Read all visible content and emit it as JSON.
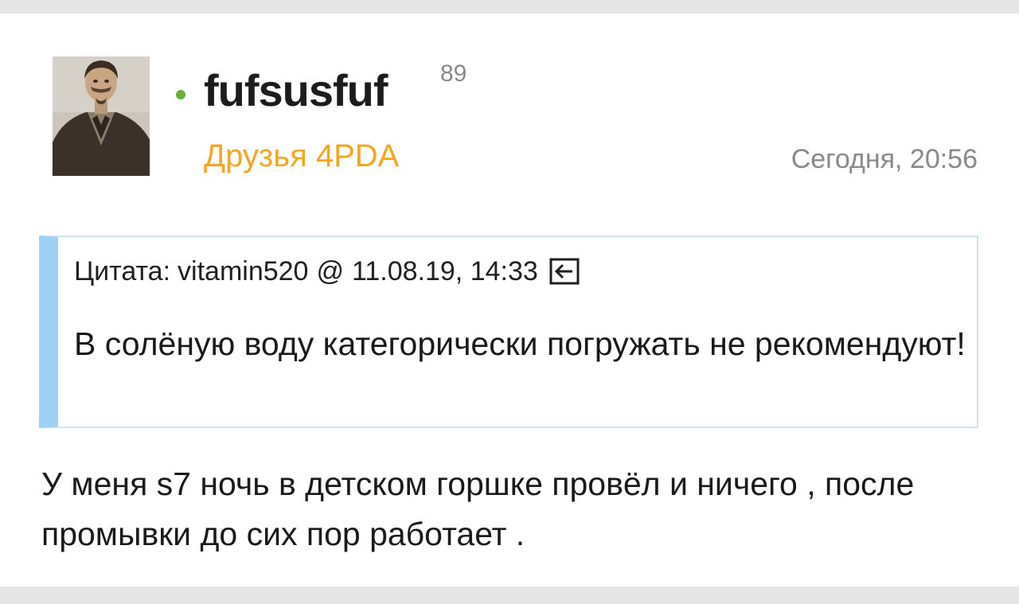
{
  "post": {
    "author": {
      "name": "fufsusfuf",
      "reputation": "89",
      "group": "Друзья 4PDA",
      "online": true,
      "avatar_icon": "user-portrait"
    },
    "date": "Сегодня, 20:56",
    "quote": {
      "label": "Цитата:",
      "author": "vitamin520",
      "at": "@",
      "datetime": "11.08.19, 14:33",
      "goto_icon": "arrow-left-box-icon",
      "text": "В солёную воду категорически погружать не рекомендуют!"
    },
    "text": "У меня s7 ночь в детском горшке провёл и ничего , после промывки до сих пор работает ."
  },
  "colors": {
    "online": "#69b03f",
    "group": "#f5a623",
    "quote_bar": "#9fd0f3",
    "quote_border": "#cce4f2",
    "page_bg": "#e6e6e6",
    "card_bg": "#ffffff"
  }
}
